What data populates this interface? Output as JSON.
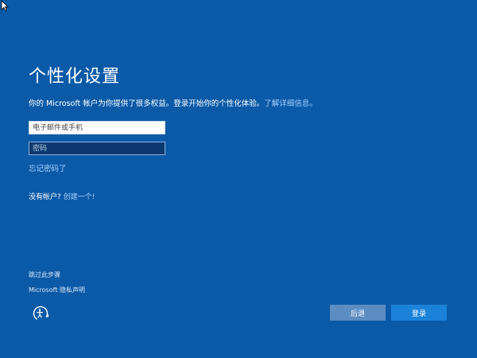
{
  "title": "个性化设置",
  "description": {
    "text": "你的 Microsoft 帐户为你提供了很多权益。登录开始你的个性化体验。",
    "link": "了解详细信息。"
  },
  "fields": {
    "email_placeholder": "电子邮件或手机",
    "password_placeholder": "密码"
  },
  "forgot_password": "忘记密码了",
  "no_account": {
    "text": "没有帐户?",
    "link": "创建一个!"
  },
  "skip_step": "跳过此步骤",
  "privacy_statement": "Microsoft 隐私声明",
  "buttons": {
    "back": "后退",
    "sign_in": "登录"
  },
  "icons": {
    "cursor": "pointer-cursor-icon",
    "ease_of_access": "ease-of-access-icon"
  },
  "colors": {
    "background": "#0b5aa8",
    "link": "#a9d3ff",
    "back_button": "#5b8cc2",
    "sign_in_button": "#1b82da"
  }
}
